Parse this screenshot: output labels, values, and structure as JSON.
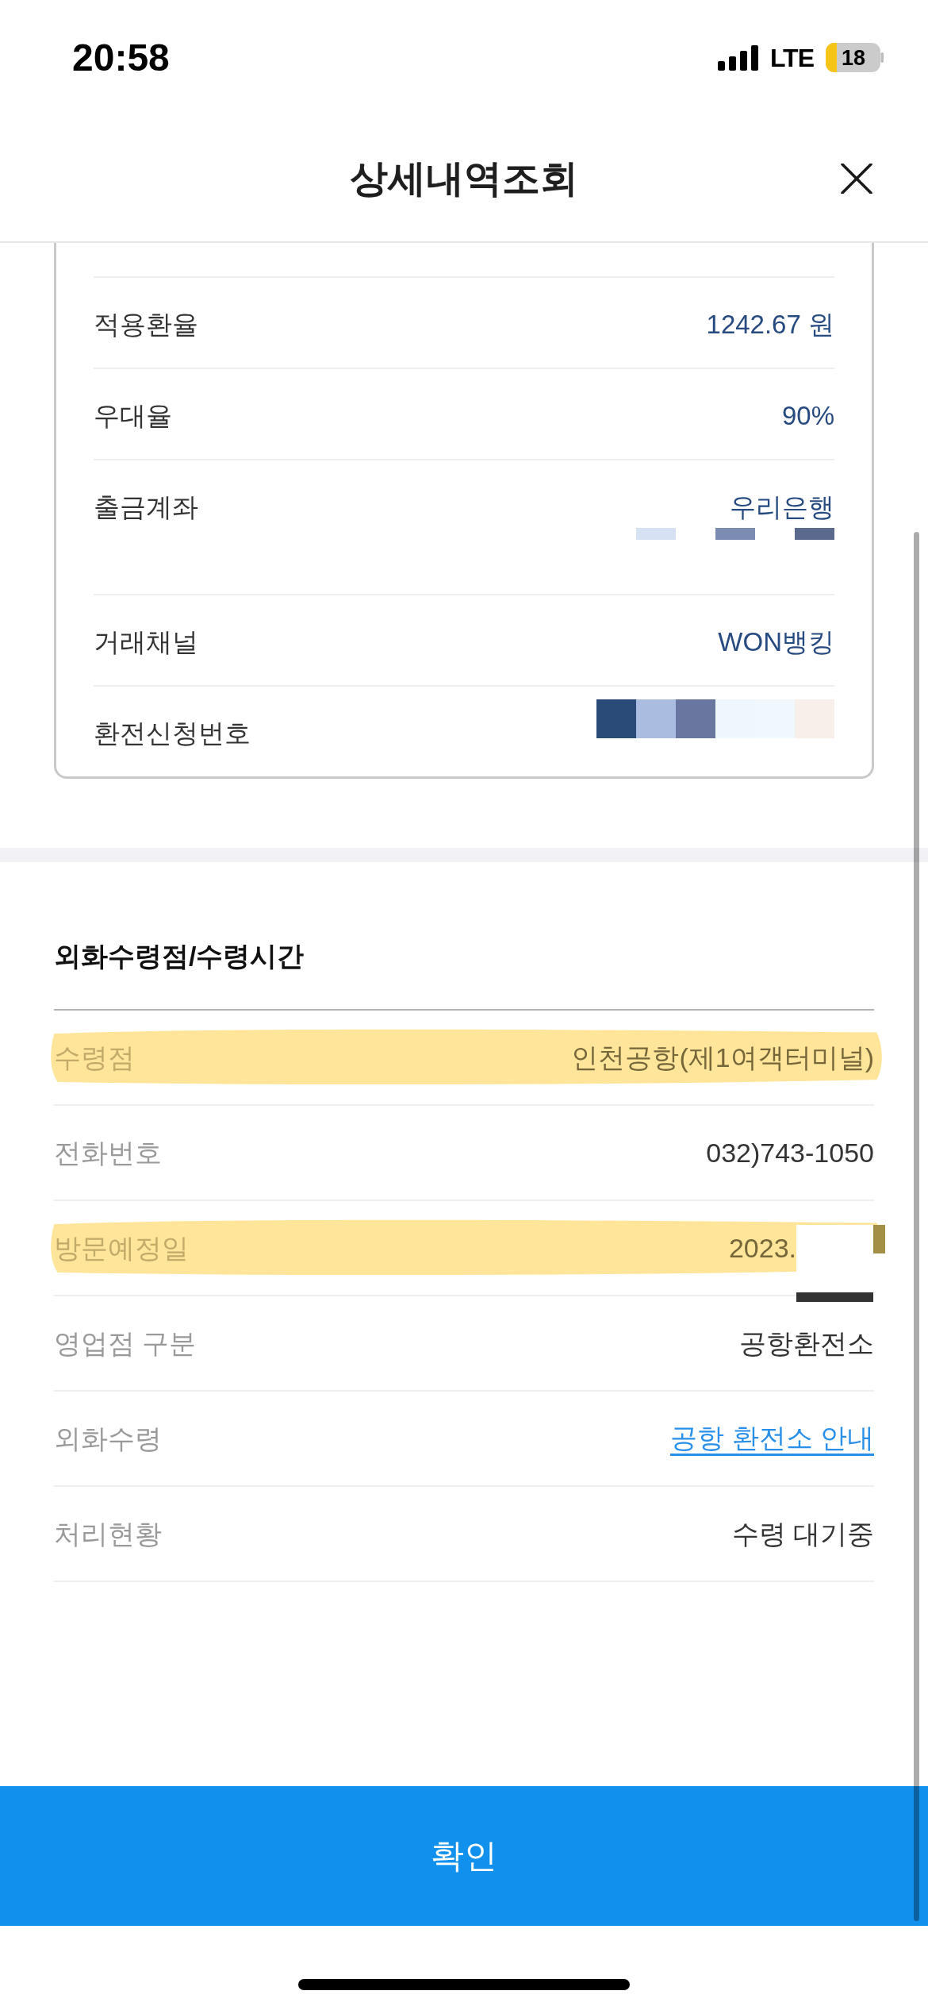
{
  "status_bar": {
    "time": "20:58",
    "network": "LTE",
    "battery": "18"
  },
  "header": {
    "title": "상세내역조회"
  },
  "exchange_details": {
    "rows": [
      {
        "label": "적용환율",
        "value": "1242.67 원",
        "redacted": false
      },
      {
        "label": "우대율",
        "value": "90%",
        "redacted": false
      },
      {
        "label": "출금계좌",
        "value": "우리은행",
        "redacted": true
      },
      {
        "label": "거래채널",
        "value": "WON뱅킹",
        "redacted": false
      },
      {
        "label": "환전신청번호",
        "redacted": true
      }
    ]
  },
  "pickup": {
    "title": "외화수령점/수령시간",
    "rows": [
      {
        "label": "수령점",
        "value": "인천공항(제1여객터미널)",
        "kind": "text",
        "highlighted": true,
        "redacted": false
      },
      {
        "label": "전화번호",
        "value": "032)743-1050",
        "kind": "text",
        "highlighted": false,
        "redacted": false
      },
      {
        "label": "방문예정일",
        "value": "2023.",
        "kind": "text",
        "highlighted": true,
        "redacted": true
      },
      {
        "label": "영업점 구분",
        "value": "공항환전소",
        "kind": "text",
        "highlighted": false,
        "redacted": false
      },
      {
        "label": "외화수령",
        "value": "공항 환전소 안내",
        "kind": "link",
        "highlighted": false,
        "redacted": false
      },
      {
        "label": "처리현황",
        "value": "수령 대기중",
        "kind": "text",
        "highlighted": false,
        "redacted": false
      }
    ]
  },
  "confirm_button": {
    "label": "확인"
  }
}
